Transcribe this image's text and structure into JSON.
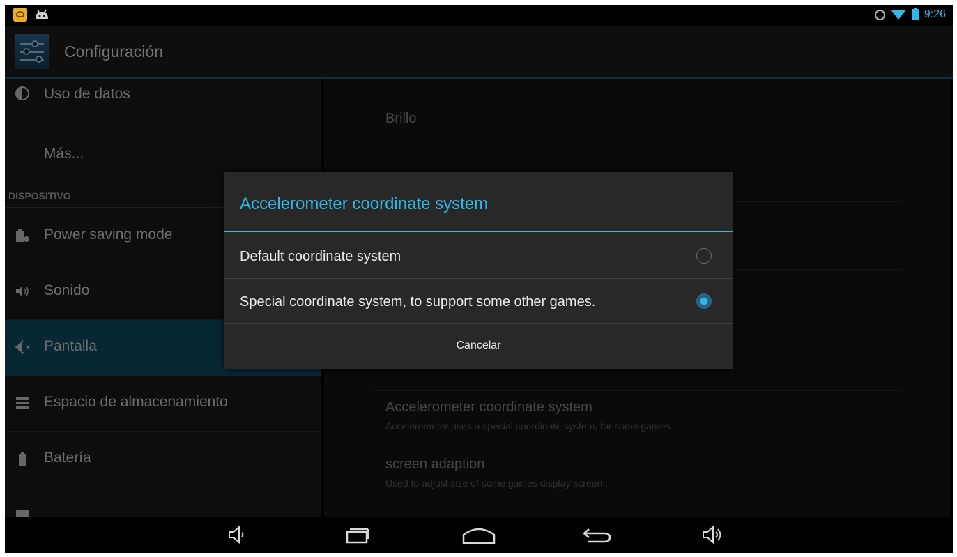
{
  "status_bar": {
    "time": "9:26"
  },
  "action_bar": {
    "title": "Configuración"
  },
  "sidebar": {
    "items_top": [
      {
        "label": "Uso de datos",
        "icon": "data-usage-icon"
      },
      {
        "label": "Más...",
        "icon": ""
      }
    ],
    "section_header": "DISPOSITIVO",
    "items": [
      {
        "label": "Power saving mode",
        "icon": "power-saving-icon"
      },
      {
        "label": "Sonido",
        "icon": "sound-icon"
      },
      {
        "label": "Pantalla",
        "icon": "display-icon",
        "selected": true
      },
      {
        "label": "Espacio de almacenamiento",
        "icon": "storage-icon"
      },
      {
        "label": "Batería",
        "icon": "battery-icon"
      }
    ]
  },
  "content": {
    "brightness": "Brillo",
    "accel_title": "Accelerometer coordinate system",
    "accel_sub": "Accelerometer uses a special coordinate system, for some games.",
    "adapt_title": "screen adaption",
    "adapt_sub": "Used to adjust size of some games display screen ."
  },
  "dialog": {
    "title": "Accelerometer coordinate system",
    "options": [
      {
        "label": "Default coordinate system",
        "selected": false
      },
      {
        "label": "Special coordinate system, to support some other games.",
        "selected": true
      }
    ],
    "cancel_label": "Cancelar"
  },
  "colors": {
    "accent": "#33b5e5",
    "selected_row": "#0f4f6b",
    "dialog_bg": "#282828"
  }
}
